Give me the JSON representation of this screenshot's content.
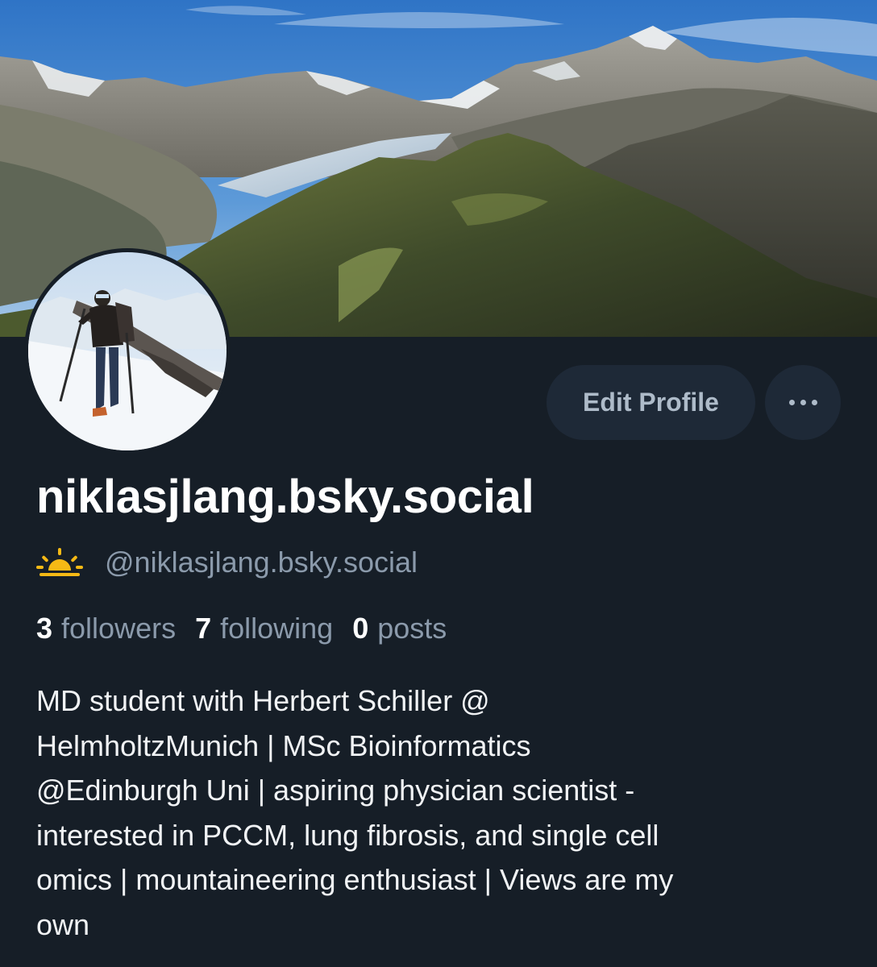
{
  "profile": {
    "display_name": "niklasjlang.bsky.social",
    "handle": "@niklasjlang.bsky.social",
    "handle_icon": "sunrise-icon",
    "bio": "MD student with Herbert Schiller @\nHelmholtzMunich | MSc Bioinformatics\n@Edinburgh Uni | aspiring physician scientist -\ninterested in PCCM, lung fibrosis, and single cell\nomics | mountaineering enthusiast | Views are my\nown"
  },
  "stats": {
    "followers_count": "3",
    "followers_label": "followers",
    "following_count": "7",
    "following_label": "following",
    "posts_count": "0",
    "posts_label": "posts"
  },
  "actions": {
    "edit_profile_label": "Edit Profile",
    "more_icon": "ellipsis-icon"
  },
  "colors": {
    "background": "#161e27",
    "button_bg": "#1e2937",
    "muted_text": "#8b9aab",
    "sun_accent": "#f5b915"
  }
}
